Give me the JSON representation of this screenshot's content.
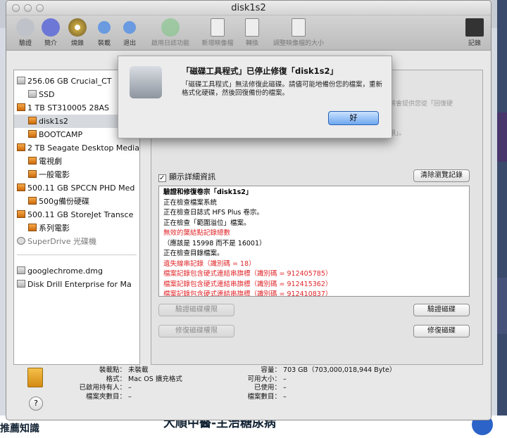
{
  "window": {
    "title": "disk1s2"
  },
  "toolbar": {
    "items": [
      "驗證",
      "簡介",
      "燒錄",
      "裝載",
      "退出",
      "啟用日誌功能",
      "新增映像檔",
      "轉換",
      "調整映像檔的大小",
      "記錄"
    ]
  },
  "sidebar": {
    "items": [
      {
        "label": "256.06 GB Crucial_CT",
        "kind": "hd",
        "indent": 0
      },
      {
        "label": "SSD",
        "kind": "hd",
        "indent": 1
      },
      {
        "label": "1 TB ST310005 28AS",
        "kind": "or",
        "indent": 0
      },
      {
        "label": "disk1s2",
        "kind": "or",
        "indent": 1,
        "selected": true
      },
      {
        "label": "BOOTCAMP",
        "kind": "or",
        "indent": 1
      },
      {
        "label": "2 TB Seagate Desktop Media",
        "kind": "or",
        "indent": 0
      },
      {
        "label": "電視劇",
        "kind": "or",
        "indent": 1
      },
      {
        "label": "一般電影",
        "kind": "or",
        "indent": 1
      },
      {
        "label": "500.11 GB SPCCN PHD Med",
        "kind": "or",
        "indent": 0
      },
      {
        "label": "500g備份硬碟",
        "kind": "or",
        "indent": 1
      },
      {
        "label": "500.11 GB StoreJet Transce",
        "kind": "or",
        "indent": 0
      },
      {
        "label": "系列電影",
        "kind": "or",
        "indent": 1
      },
      {
        "label": "SuperDrive 光碟機",
        "kind": "cd",
        "indent": 0
      },
      {
        "label": "googlechrome.dmg",
        "kind": "hd",
        "indent": 0
      },
      {
        "label": "Disk Drill Enterprise for Ma",
        "kind": "hd",
        "indent": 0
      }
    ]
  },
  "details": {
    "checkbox_label": "顯示詳細資訊",
    "clear_label": "清除瀏覽記錄"
  },
  "log": [
    {
      "t": "驗證和修復卷宗「disk1s2」",
      "red": false
    },
    {
      "t": "正在檢查檔案系統",
      "red": false
    },
    {
      "t": "正在檢查日誌式 HFS Plus 卷宗。",
      "red": false
    },
    {
      "t": "正在檢查「範圍溢位」檔案。",
      "red": false
    },
    {
      "t": "無效的葉結點記錄總數",
      "red": true
    },
    {
      "t": "（應該是 15998 而不是 16001）",
      "red": false
    },
    {
      "t": "正在檢查目錄檔案。",
      "red": false
    },
    {
      "t": "遺失線串記錄（識別碼 = 18）",
      "red": true
    },
    {
      "t": "檔案記錄包含硬式連結串旗標（識別碼 = 912405785）",
      "red": true
    },
    {
      "t": "檔案記錄包含硬式連結串旗標（識別碼 = 912415362）",
      "red": true
    },
    {
      "t": "檔案記錄包含硬式連結串旗標（識別碼 = 912410837）",
      "red": true
    }
  ],
  "buttons": {
    "verify_perm": "驗證磁碟權限",
    "verify_disk": "驗證磁碟",
    "repair_perm": "修復磁碟權限",
    "repair_disk": "修復磁碟"
  },
  "info": {
    "mount_point_k": "裝載點：",
    "mount_point_v": "未裝載",
    "format_k": "格式：",
    "format_v": "Mac OS 擴充格式",
    "owners_k": "已啟用持有人：",
    "owners_v": "–",
    "folders_k": "檔案夾數目：",
    "folders_v": "–",
    "capacity_k": "容量：",
    "capacity_v": "703 GB（703,000,018,944 Byte）",
    "available_k": "可用大小：",
    "available_v": "–",
    "used_k": "已使用：",
    "used_v": "–",
    "files_k": "檔案數目：",
    "files_v": "–"
  },
  "alert": {
    "title": "「磁碟工具程式」已停止修復「disk1s2」",
    "message": "「磁碟工具程式」無法修復此磁碟。請儘可能地備份您的檔案，重新格式化硬碟，然後回復備份的檔案。",
    "ok": "好"
  },
  "background": {
    "left_text": "推薦知識",
    "mid_text": "大順中醫-主治糖尿病"
  },
  "faded": {
    "a": "將會提供您從「回復硬",
    "b": "限」。"
  },
  "help": "?"
}
